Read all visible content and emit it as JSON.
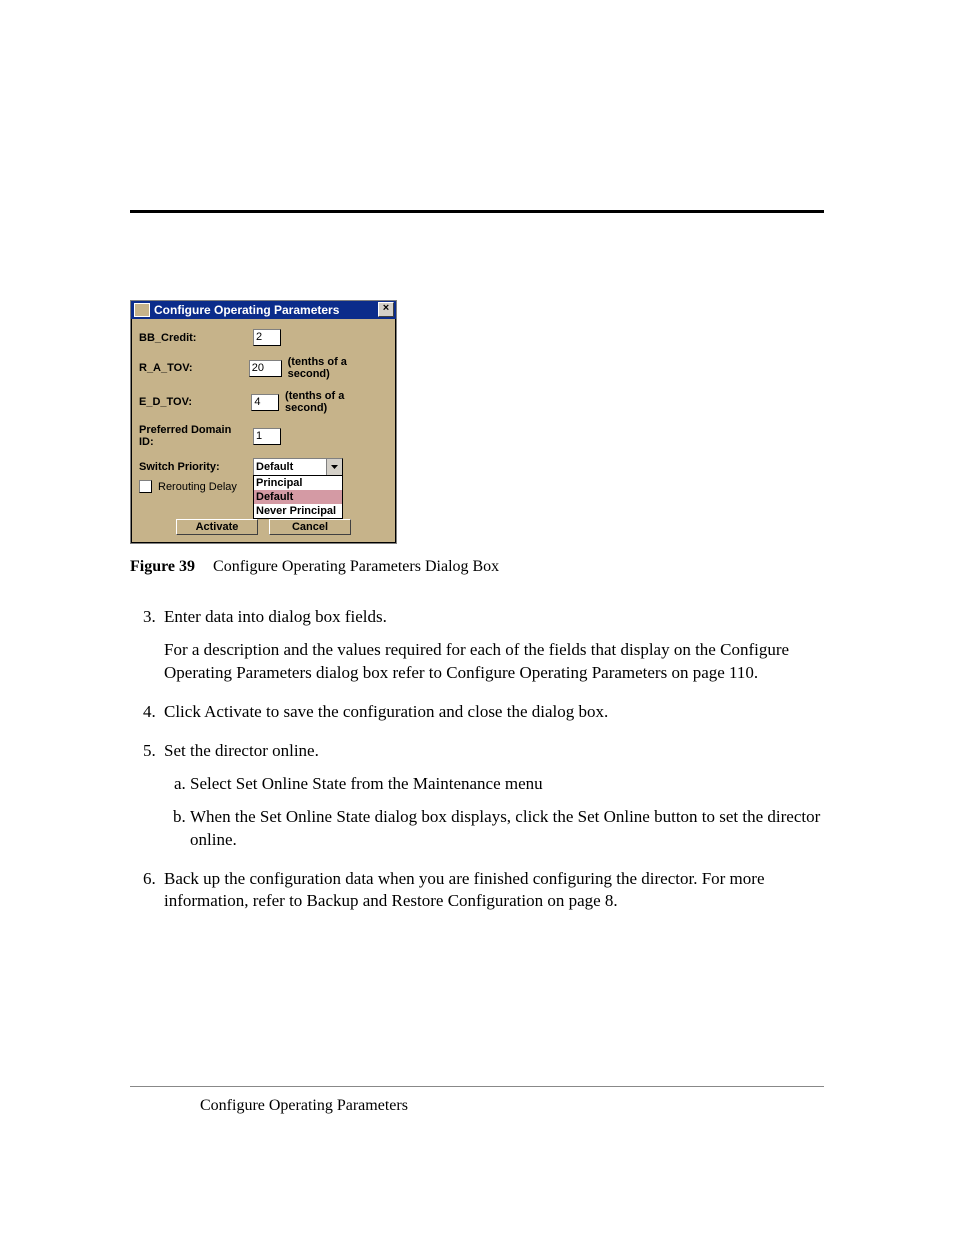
{
  "dialog": {
    "title": "Configure Operating Parameters",
    "close_glyph": "×",
    "rows": {
      "bb_credit": {
        "label": "BB_Credit:",
        "value": "2"
      },
      "ra_tov": {
        "label": "R_A_TOV:",
        "value": "20",
        "unit": "(tenths of a second)"
      },
      "ed_tov": {
        "label": "E_D_TOV:",
        "value": "4",
        "unit": "(tenths of a second)"
      },
      "pref_dom": {
        "label": "Preferred Domain ID:",
        "value": "1"
      },
      "priority": {
        "label": "Switch Priority:",
        "selected": "Default",
        "options": [
          "Principal",
          "Default",
          "Never Principal"
        ]
      }
    },
    "reroute_label": "Rerouting Delay",
    "buttons": {
      "activate": "Activate",
      "cancel": "Cancel"
    }
  },
  "caption": {
    "label": "Figure 39",
    "text": "Configure Operating Parameters Dialog Box"
  },
  "steps": {
    "s3": {
      "lead": "Enter data into dialog box fields.",
      "para": "For a description and the values required for each of the fields that display on the Configure Operating Parameters dialog box refer to Configure Operating Parameters on page 110."
    },
    "s4": "Click Activate to save the configuration and close the dialog box.",
    "s5": {
      "lead": "Set the director online.",
      "a": "Select Set Online State from the Maintenance menu",
      "b": "When the Set Online State dialog box displays, click the Set Online button to set the director online."
    },
    "s6": "Back up the configuration data when you are finished configuring the director. For more information, refer to Backup and Restore Configuration on page 8."
  },
  "footer": "Configure Operating Parameters"
}
